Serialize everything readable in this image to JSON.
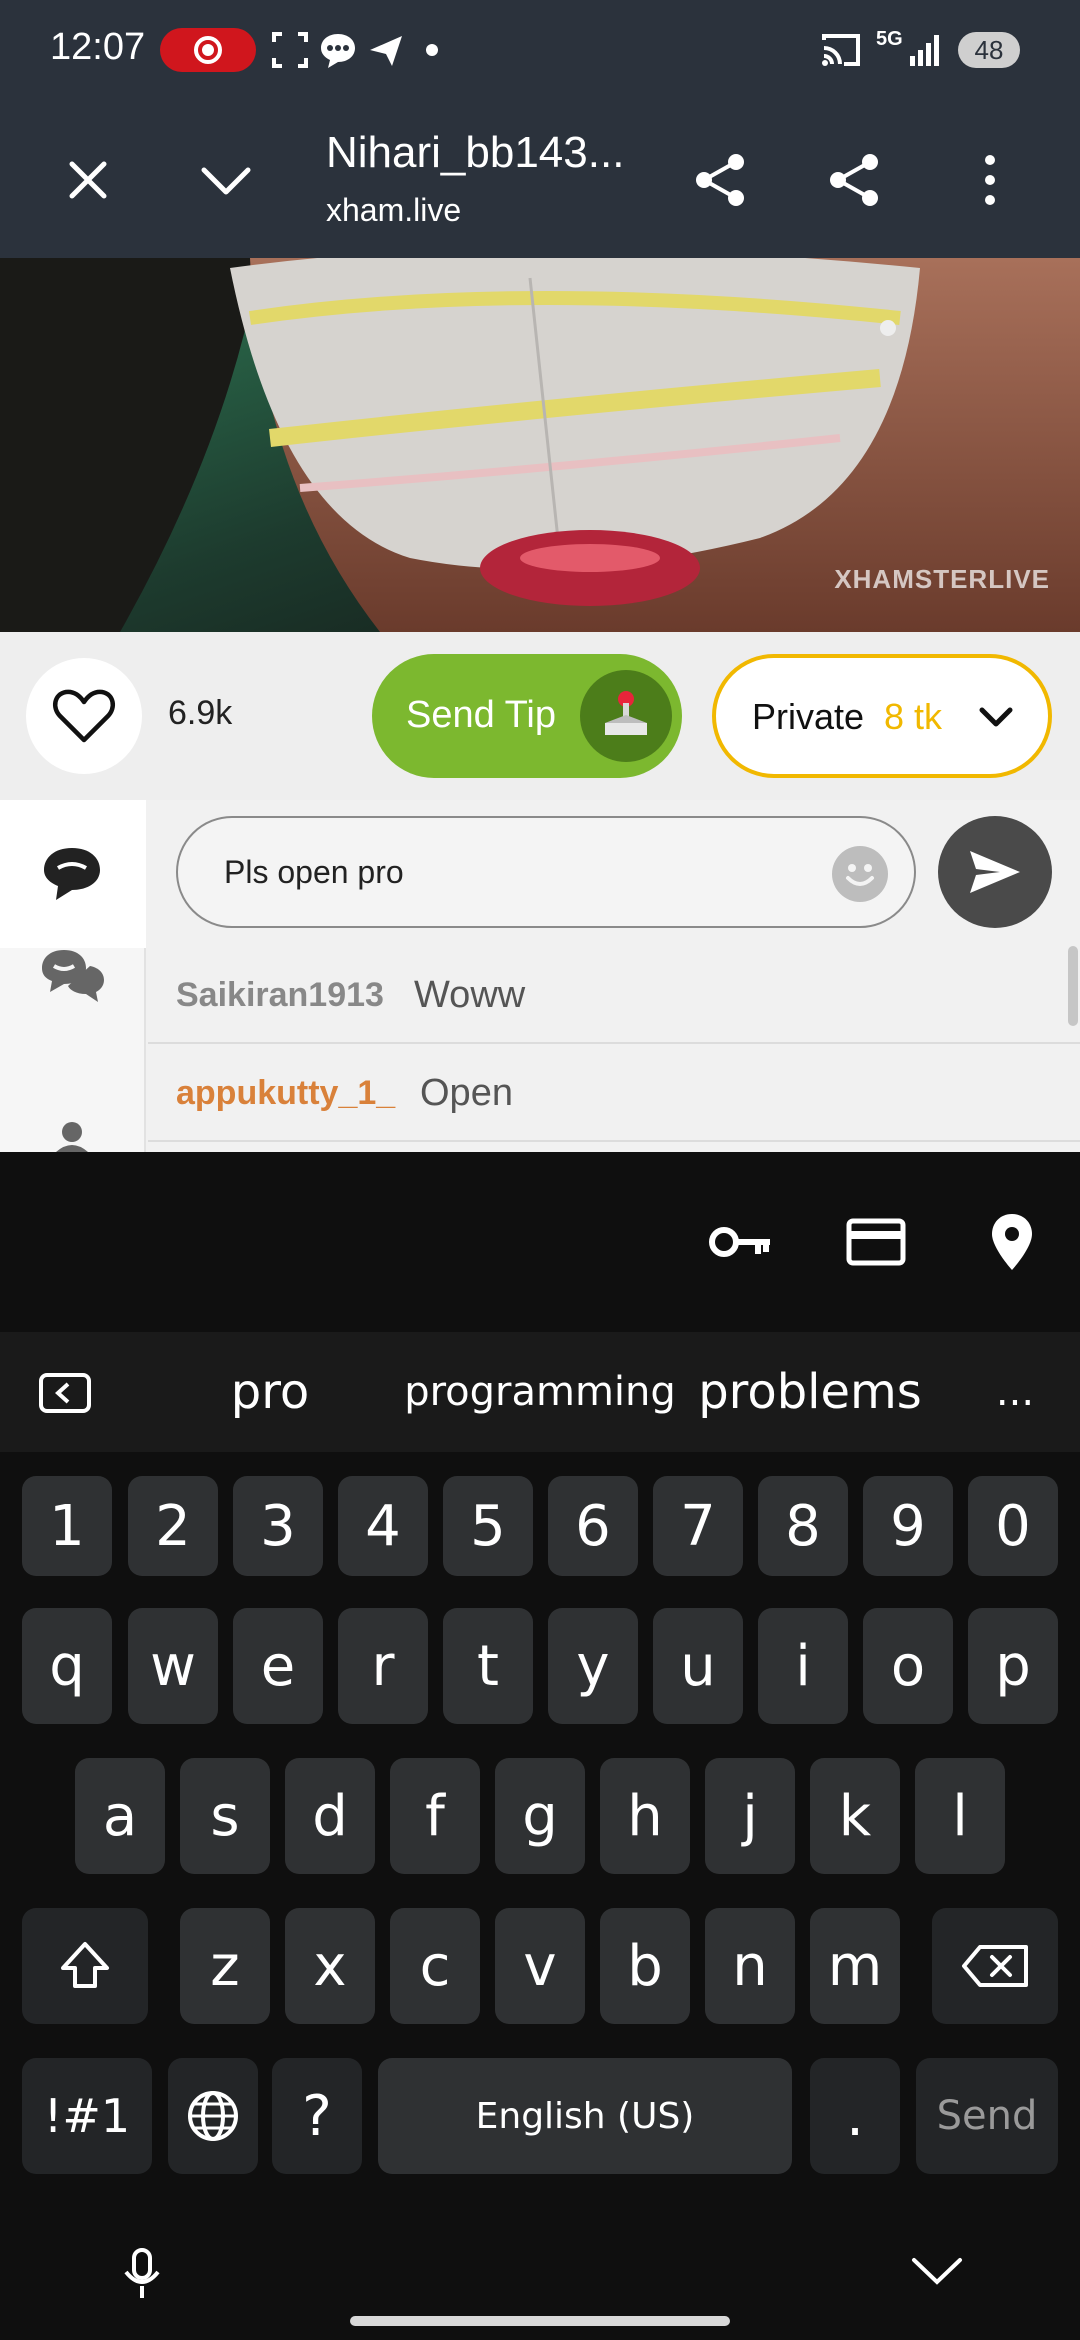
{
  "status_bar": {
    "time": "12:07",
    "network": "5G",
    "battery": "48",
    "colors": {
      "bg": "#2b323c",
      "record": "#d0161d"
    }
  },
  "app_bar": {
    "title": "Nihari_bb143...",
    "subtitle": "xham.live"
  },
  "video": {
    "watermark": "XHAMSTERLIVE"
  },
  "actions": {
    "like_count": "6.9k",
    "send_tip_label": "Send Tip",
    "private_label": "Private",
    "private_price": "8 tk",
    "colors": {
      "tip": "#7cb82f",
      "private_border": "#f1b800",
      "price": "#f1b800"
    }
  },
  "chat": {
    "input_value": "Pls open pro",
    "messages": [
      {
        "user": "Saikiran1913",
        "text": "Woww",
        "user_color": "#888888"
      },
      {
        "user": "appukutty_1_",
        "text": "Open",
        "user_color": "#d9813a"
      }
    ]
  },
  "keyboard": {
    "suggestions": [
      "pro",
      "programming",
      "problems"
    ],
    "more_label": "...",
    "number_row": [
      "1",
      "2",
      "3",
      "4",
      "5",
      "6",
      "7",
      "8",
      "9",
      "0"
    ],
    "row1": [
      "q",
      "w",
      "e",
      "r",
      "t",
      "y",
      "u",
      "i",
      "o",
      "p"
    ],
    "row2": [
      "a",
      "s",
      "d",
      "f",
      "g",
      "h",
      "j",
      "k",
      "l"
    ],
    "row3": [
      "z",
      "x",
      "c",
      "v",
      "b",
      "n",
      "m"
    ],
    "symbols_label": "!#1",
    "question_label": "?",
    "space_label": "English (US)",
    "period_label": ".",
    "send_label": "Send"
  }
}
